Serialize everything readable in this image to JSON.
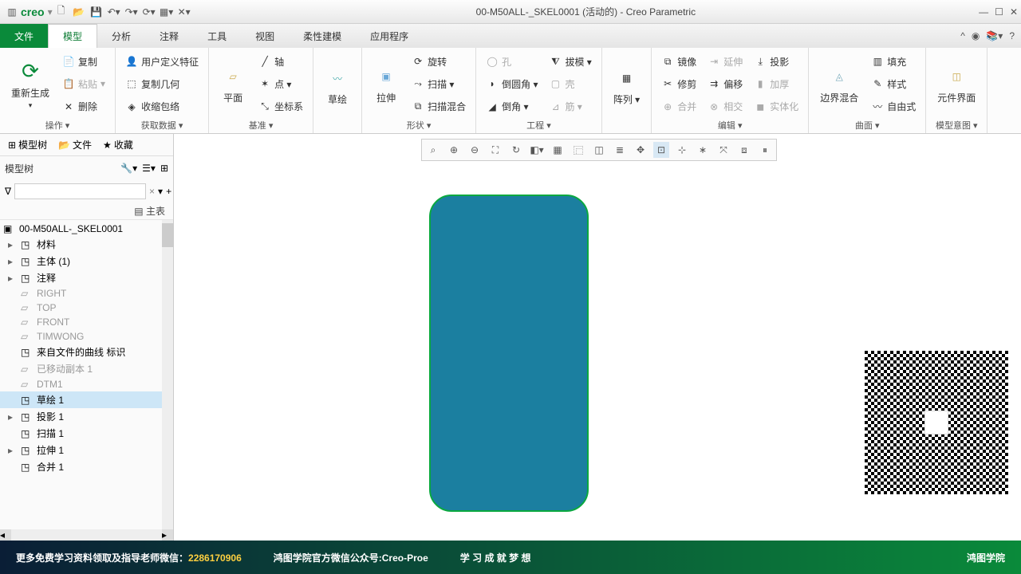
{
  "app": {
    "brand": "creo",
    "title": "00-M50ALL-_SKEL0001 (活动的) - Creo Parametric"
  },
  "menu": {
    "file": "文件",
    "tabs": [
      "模型",
      "分析",
      "注释",
      "工具",
      "视图",
      "柔性建模",
      "应用程序"
    ],
    "active": 0
  },
  "ribbon": {
    "g1": {
      "regen": "重新生成",
      "copy": "复制",
      "paste": "粘贴",
      "delete": "删除",
      "label": "操作 ▾"
    },
    "g2": {
      "udf": "用户定义特征",
      "copygeom": "复制几何",
      "shrink": "收缩包络",
      "label": "获取数据 ▾"
    },
    "g3": {
      "plane": "平面",
      "axis": "轴",
      "point": "点 ▾",
      "csys": "坐标系",
      "label": "基准 ▾"
    },
    "g4": {
      "sketch": "草绘"
    },
    "g5": {
      "extrude": "拉伸",
      "revolve": "旋转",
      "sweep": "扫描 ▾",
      "blend": "扫描混合",
      "label": "形状 ▾"
    },
    "g6": {
      "hole": "孔",
      "round": "倒圆角 ▾",
      "chamfer": "倒角 ▾",
      "draft": "拔模 ▾",
      "shell": "壳",
      "rib": "筋 ▾",
      "label": "工程 ▾"
    },
    "g7": {
      "pattern": "阵列 ▾"
    },
    "g8": {
      "mirror": "镜像",
      "trim": "修剪",
      "merge": "合并",
      "extend": "延伸",
      "offset": "偏移",
      "intersect": "相交",
      "project": "投影",
      "thicken": "加厚",
      "solidify": "实体化",
      "label": "编辑 ▾"
    },
    "g9": {
      "boundary": "边界混合",
      "fill": "填充",
      "style": "样式",
      "freeform": "自由式",
      "label": "曲面 ▾"
    },
    "g10": {
      "compif": "元件界面",
      "label": "模型意图 ▾"
    }
  },
  "side": {
    "tabs": {
      "model": "模型树",
      "file": "文件",
      "fav": "收藏"
    },
    "tree_label": "模型树",
    "main_table": "主表",
    "root": "00-M50ALL-_SKEL0001",
    "items": [
      {
        "t": "材料",
        "exp": true
      },
      {
        "t": "主体 (1)",
        "exp": true
      },
      {
        "t": "注释",
        "exp": true
      },
      {
        "t": "RIGHT",
        "dim": true
      },
      {
        "t": "TOP",
        "dim": true
      },
      {
        "t": "FRONT",
        "dim": true
      },
      {
        "t": "TIMWONG",
        "dim": true
      },
      {
        "t": "来自文件的曲线 标识"
      },
      {
        "t": "已移动副本 1",
        "dim": true
      },
      {
        "t": "DTM1",
        "dim": true
      },
      {
        "t": "草绘 1",
        "sel": true
      },
      {
        "t": "投影 1",
        "exp": true
      },
      {
        "t": "扫描 1"
      },
      {
        "t": "拉伸 1",
        "exp": true
      },
      {
        "t": "合并 1"
      }
    ]
  },
  "footer": {
    "s1a": "更多免费学习资料领取及指导老师微信：",
    "s1b": "2286170906",
    "s2": "鸿图学院官方微信公众号:Creo-Proe",
    "s3": "学 习 成 就 梦 想",
    "s4": "鸿图学院"
  }
}
